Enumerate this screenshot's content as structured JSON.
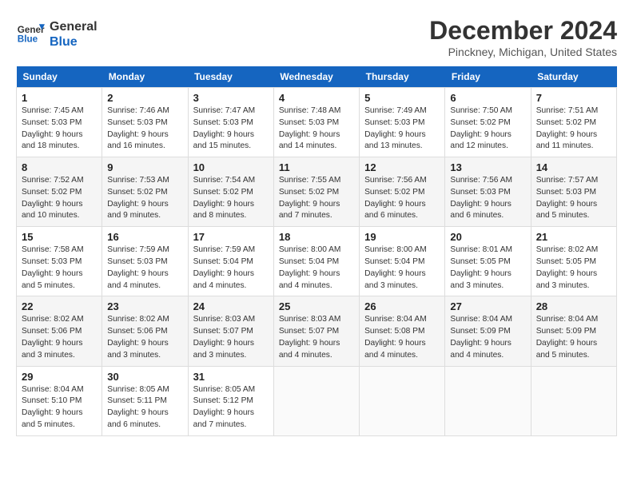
{
  "logo": {
    "line1": "General",
    "line2": "Blue"
  },
  "title": "December 2024",
  "location": "Pinckney, Michigan, United States",
  "days_of_week": [
    "Sunday",
    "Monday",
    "Tuesday",
    "Wednesday",
    "Thursday",
    "Friday",
    "Saturday"
  ],
  "weeks": [
    [
      {
        "num": "1",
        "sunrise": "7:45 AM",
        "sunset": "5:03 PM",
        "daylight": "9 hours and 18 minutes."
      },
      {
        "num": "2",
        "sunrise": "7:46 AM",
        "sunset": "5:03 PM",
        "daylight": "9 hours and 16 minutes."
      },
      {
        "num": "3",
        "sunrise": "7:47 AM",
        "sunset": "5:03 PM",
        "daylight": "9 hours and 15 minutes."
      },
      {
        "num": "4",
        "sunrise": "7:48 AM",
        "sunset": "5:03 PM",
        "daylight": "9 hours and 14 minutes."
      },
      {
        "num": "5",
        "sunrise": "7:49 AM",
        "sunset": "5:03 PM",
        "daylight": "9 hours and 13 minutes."
      },
      {
        "num": "6",
        "sunrise": "7:50 AM",
        "sunset": "5:02 PM",
        "daylight": "9 hours and 12 minutes."
      },
      {
        "num": "7",
        "sunrise": "7:51 AM",
        "sunset": "5:02 PM",
        "daylight": "9 hours and 11 minutes."
      }
    ],
    [
      {
        "num": "8",
        "sunrise": "7:52 AM",
        "sunset": "5:02 PM",
        "daylight": "9 hours and 10 minutes."
      },
      {
        "num": "9",
        "sunrise": "7:53 AM",
        "sunset": "5:02 PM",
        "daylight": "9 hours and 9 minutes."
      },
      {
        "num": "10",
        "sunrise": "7:54 AM",
        "sunset": "5:02 PM",
        "daylight": "9 hours and 8 minutes."
      },
      {
        "num": "11",
        "sunrise": "7:55 AM",
        "sunset": "5:02 PM",
        "daylight": "9 hours and 7 minutes."
      },
      {
        "num": "12",
        "sunrise": "7:56 AM",
        "sunset": "5:02 PM",
        "daylight": "9 hours and 6 minutes."
      },
      {
        "num": "13",
        "sunrise": "7:56 AM",
        "sunset": "5:03 PM",
        "daylight": "9 hours and 6 minutes."
      },
      {
        "num": "14",
        "sunrise": "7:57 AM",
        "sunset": "5:03 PM",
        "daylight": "9 hours and 5 minutes."
      }
    ],
    [
      {
        "num": "15",
        "sunrise": "7:58 AM",
        "sunset": "5:03 PM",
        "daylight": "9 hours and 5 minutes."
      },
      {
        "num": "16",
        "sunrise": "7:59 AM",
        "sunset": "5:03 PM",
        "daylight": "9 hours and 4 minutes."
      },
      {
        "num": "17",
        "sunrise": "7:59 AM",
        "sunset": "5:04 PM",
        "daylight": "9 hours and 4 minutes."
      },
      {
        "num": "18",
        "sunrise": "8:00 AM",
        "sunset": "5:04 PM",
        "daylight": "9 hours and 4 minutes."
      },
      {
        "num": "19",
        "sunrise": "8:00 AM",
        "sunset": "5:04 PM",
        "daylight": "9 hours and 3 minutes."
      },
      {
        "num": "20",
        "sunrise": "8:01 AM",
        "sunset": "5:05 PM",
        "daylight": "9 hours and 3 minutes."
      },
      {
        "num": "21",
        "sunrise": "8:02 AM",
        "sunset": "5:05 PM",
        "daylight": "9 hours and 3 minutes."
      }
    ],
    [
      {
        "num": "22",
        "sunrise": "8:02 AM",
        "sunset": "5:06 PM",
        "daylight": "9 hours and 3 minutes."
      },
      {
        "num": "23",
        "sunrise": "8:02 AM",
        "sunset": "5:06 PM",
        "daylight": "9 hours and 3 minutes."
      },
      {
        "num": "24",
        "sunrise": "8:03 AM",
        "sunset": "5:07 PM",
        "daylight": "9 hours and 3 minutes."
      },
      {
        "num": "25",
        "sunrise": "8:03 AM",
        "sunset": "5:07 PM",
        "daylight": "9 hours and 4 minutes."
      },
      {
        "num": "26",
        "sunrise": "8:04 AM",
        "sunset": "5:08 PM",
        "daylight": "9 hours and 4 minutes."
      },
      {
        "num": "27",
        "sunrise": "8:04 AM",
        "sunset": "5:09 PM",
        "daylight": "9 hours and 4 minutes."
      },
      {
        "num": "28",
        "sunrise": "8:04 AM",
        "sunset": "5:09 PM",
        "daylight": "9 hours and 5 minutes."
      }
    ],
    [
      {
        "num": "29",
        "sunrise": "8:04 AM",
        "sunset": "5:10 PM",
        "daylight": "9 hours and 5 minutes."
      },
      {
        "num": "30",
        "sunrise": "8:05 AM",
        "sunset": "5:11 PM",
        "daylight": "9 hours and 6 minutes."
      },
      {
        "num": "31",
        "sunrise": "8:05 AM",
        "sunset": "5:12 PM",
        "daylight": "9 hours and 7 minutes."
      },
      null,
      null,
      null,
      null
    ]
  ]
}
